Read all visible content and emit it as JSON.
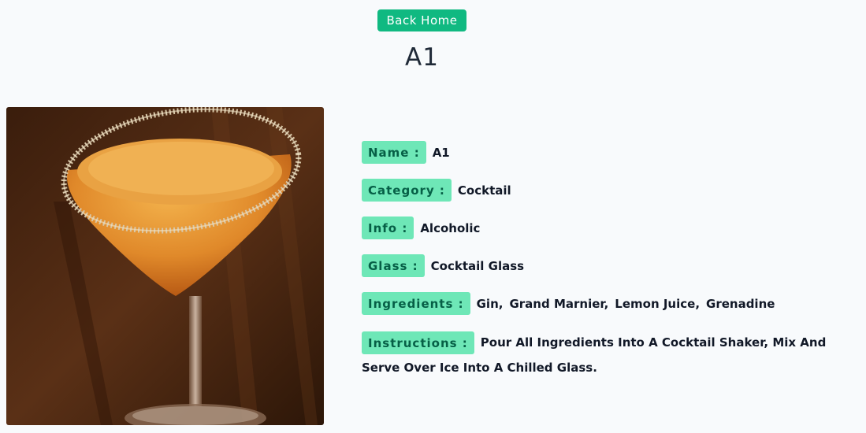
{
  "header": {
    "back_label": "Back Home",
    "title": "A1"
  },
  "image": {
    "alt": "A1"
  },
  "details": {
    "name_label": "Name :",
    "name_value": "A1",
    "category_label": "Category :",
    "category_value": "Cocktail",
    "info_label": "Info :",
    "info_value": "Alcoholic",
    "glass_label": "Glass :",
    "glass_value": "Cocktail Glass",
    "ingredients_label": "Ingredients :",
    "ingredients": [
      "Gin,",
      "Grand Marnier,",
      "Lemon Juice,",
      "Grenadine"
    ],
    "instructions_label": "Instructions :",
    "instructions_value": "Pour All Ingredients Into A Cocktail Shaker, Mix And Serve Over Ice Into A Chilled Glass."
  },
  "colors": {
    "accent": "#10b981",
    "chip_bg": "#6ee7b7",
    "chip_text": "#065f46",
    "background": "#f8fafc"
  }
}
